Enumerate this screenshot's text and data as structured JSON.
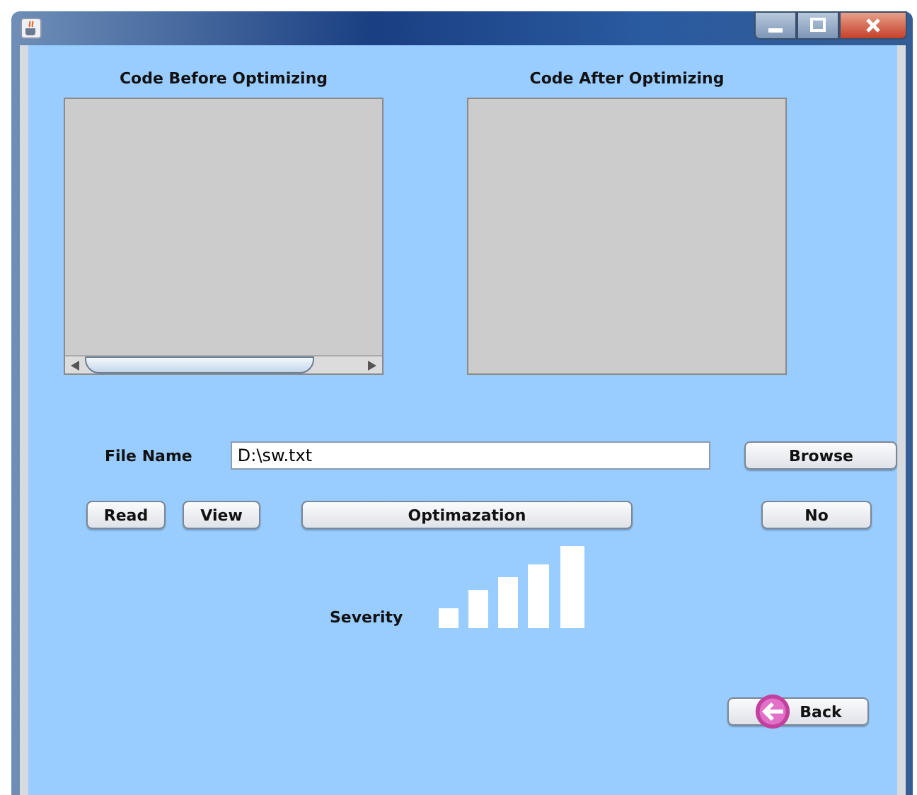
{
  "window": {
    "title_buttons": [
      {
        "kind": "minimize"
      },
      {
        "kind": "maximize"
      },
      {
        "kind": "close"
      }
    ]
  },
  "panels": [
    {
      "title": "Code Before Optimizing",
      "horizontal_scrollbar": true
    },
    {
      "title": "Code After Optimizing",
      "horizontal_scrollbar": false
    }
  ],
  "file_name": {
    "label": "File Name",
    "value": "D:\\sw.txt"
  },
  "browse_button": "Browse",
  "buttons": [
    "Read",
    "View",
    "Optimazation",
    "No"
  ],
  "severity": {
    "label": "Severity"
  },
  "back_button": "Back"
}
